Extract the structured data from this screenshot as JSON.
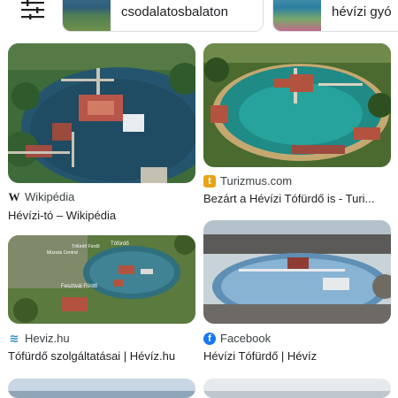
{
  "chips": [
    {
      "label": "csodalatosbalaton"
    },
    {
      "label": "hévízi gyó"
    }
  ],
  "results": [
    {
      "source": "Wikipédia",
      "source_icon": "wikipedia-icon",
      "title": "Hévízi-tó – Wikipédia"
    },
    {
      "source": "Turizmus.com",
      "source_icon": "turizmus-icon",
      "title": "Bezárt a Hévízi Tófürdő is - Turi..."
    },
    {
      "source": "Heviz.hu",
      "source_icon": "heviz-icon",
      "title": "Tófürdő szolgáltatásai | Hévíz.hu",
      "image_labels": [
        "Tófürdő",
        "Tófürdő Fürdő",
        "Múzsás Central",
        "Fesztivál Fürdő"
      ]
    },
    {
      "source": "Facebook",
      "source_icon": "facebook-icon",
      "title": "Hévízi Tófürdő | Hévíz"
    }
  ],
  "colors": {
    "wiki": "#202124",
    "turizmus": "#e8a317",
    "heviz": "#2a8fc7",
    "facebook": "#1877f2"
  }
}
